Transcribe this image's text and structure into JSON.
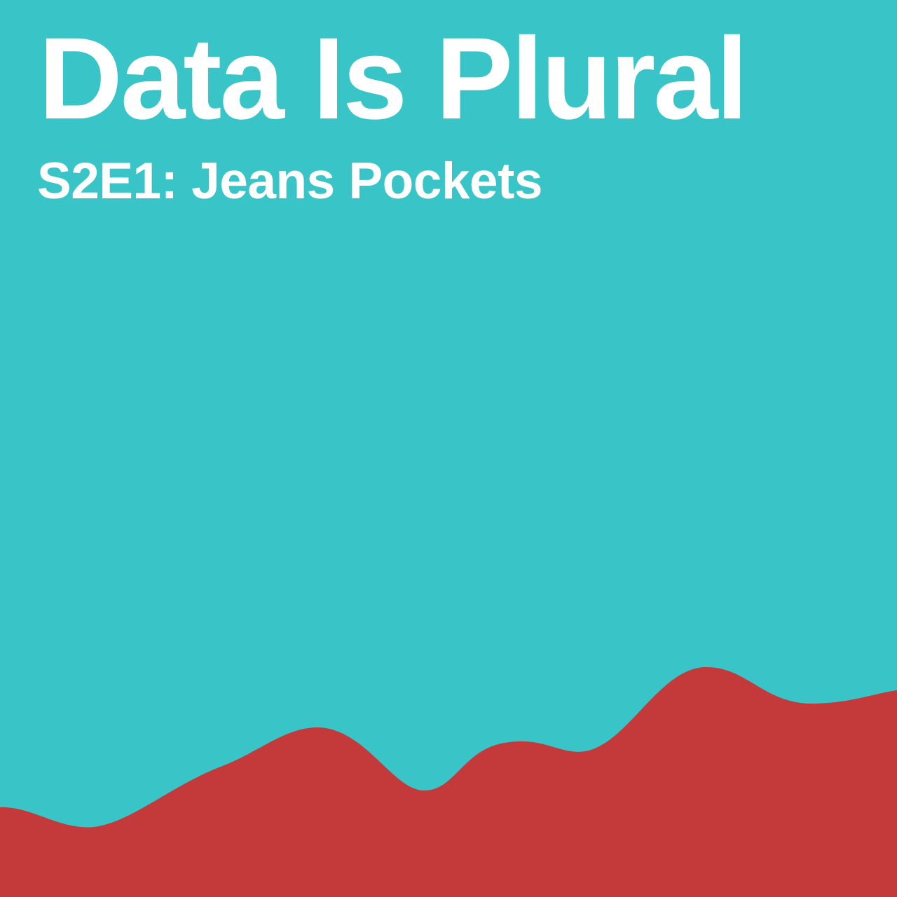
{
  "cover": {
    "title": "Data Is Plural",
    "subtitle": "S2E1: Jeans Pockets"
  },
  "colors": {
    "background": "#39c5c7",
    "wave": "#c4393a",
    "text": "#ffffff"
  }
}
